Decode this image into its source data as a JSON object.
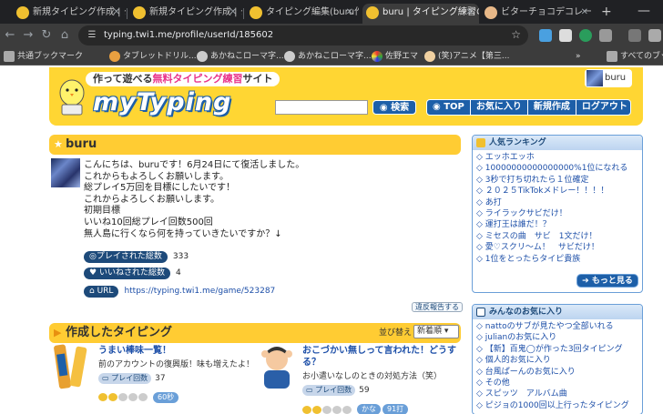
{
  "browser": {
    "tabs": [
      {
        "title": "新規タイピング作成 | タ"
      },
      {
        "title": "新規タイピング作成 | タ"
      },
      {
        "title": "タイピング編集(buru作"
      },
      {
        "title": "buru | タイピング練習の"
      },
      {
        "title": "ビターチョコデコレー"
      }
    ],
    "new_tab_symbol": "+",
    "minimize_symbol": "—",
    "url": "typing.twi1.me/profile/userId/185602",
    "bookmarks": [
      {
        "label": "共通ブックマーク"
      },
      {
        "label": "タブレットドリル..."
      },
      {
        "label": "あかねこローマ字..."
      },
      {
        "label": "あかねこローマ字..."
      },
      {
        "label": "佐野エマ"
      },
      {
        "label": "(笑)アニメ【第三..."
      }
    ],
    "bookmarks_more": "»",
    "all_bookmarks": "すべてのブッ"
  },
  "header": {
    "tagline_prefix": "作って遊べる",
    "tagline_highlight": "無料タイピング練習",
    "tagline_suffix": "サイト",
    "logo": "myTyping",
    "search_button": "検索",
    "nav": [
      "TOP",
      "お気に入り",
      "新規作成",
      "ログアウト"
    ],
    "username": "buru"
  },
  "profile": {
    "name": "buru",
    "bio": "こんにちは、buruです！6月24日にて復活しました。\nこれからもよろしくお願いします。\n総プレイ5万回を目標にしたいです！\nこれからよろしくお願いします。\n初期目標\nいいね10回総プレイ回数500回\n無人島に行くなら何を持っていきたいですか？↓",
    "stats": [
      {
        "label": "プレイされた総数",
        "value": "333"
      },
      {
        "label": "いいねされた総数",
        "value": "4"
      }
    ],
    "url_label": "URL",
    "url": "https://typing.twi1.me/game/523287",
    "report_label": "違反報告する"
  },
  "games_section": {
    "title": "作成したタイピング",
    "sort_label": "並び替え",
    "sort_value": "新着順",
    "games": [
      {
        "title": "うまい棒味一覧！",
        "desc": "前のアカウントの復興版！味も増えたよ！",
        "play_label": "プレイ回数",
        "plays": "37",
        "stars_on": 2,
        "tags": [
          "60秒"
        ]
      },
      {
        "title": "おこづかい無しって言われた！どうする？",
        "desc": "お小遣いなしのときの対処方法（笑）",
        "play_label": "プレイ回数",
        "plays": "59",
        "stars_on": 2,
        "tags": [
          "かな",
          "91打"
        ]
      }
    ]
  },
  "sidebar": {
    "ranking": {
      "title": "人気ランキング",
      "items": [
        "エッホエッホ",
        "10000000000000000%1位になれる",
        "3秒で打ち切れたら１位確定",
        "２０２５TikTokメドレー！！！！",
        "あ打",
        "ライラックサビだけ！",
        "運打王は誰だ！？",
        "ミセスの曲　サビ　1文だけ！",
        "愛♡スクリ～ム！　サビだけ！",
        "1位をとったらタイピ貴族"
      ],
      "more": "もっと見る"
    },
    "favorites": {
      "title": "みんなのお気に入り",
      "items": [
        "nattoのサブが見たやつ全部いれる",
        "julianのお気に入り",
        "【新】百鬼◯が作った3回タイピング",
        "個人的お気に入り",
        "台風ぱーんのお気に入り",
        "その他",
        "スピッツ　アルバム曲",
        "ピジョの1000回以上行ったタイピング"
      ]
    }
  },
  "colors": {
    "accent": "#ffcc33",
    "link": "#1d4fa8",
    "nav": "#1d5fa8"
  }
}
